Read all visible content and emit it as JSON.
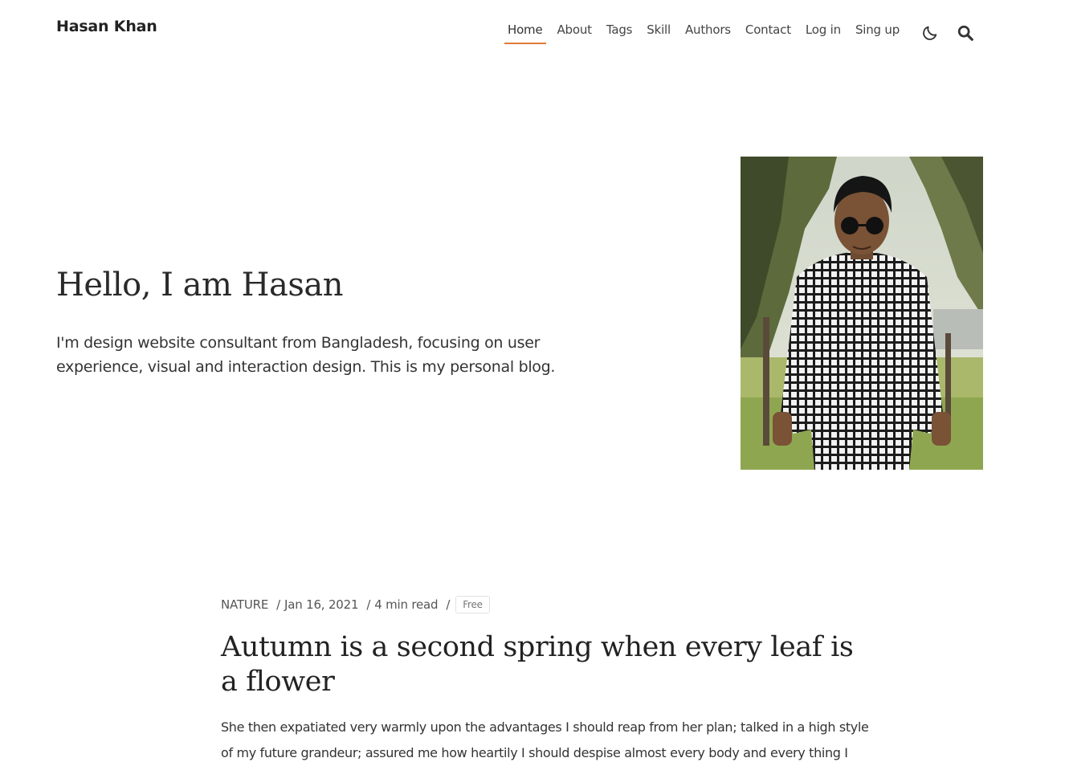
{
  "header": {
    "site_title": "Hasan Khan",
    "nav": [
      {
        "label": "Home",
        "active": true
      },
      {
        "label": "About"
      },
      {
        "label": "Tags"
      },
      {
        "label": "Skill"
      },
      {
        "label": "Authors"
      },
      {
        "label": "Contact"
      },
      {
        "label": "Log in"
      },
      {
        "label": "Sing up"
      }
    ],
    "icons": [
      "moon-icon",
      "search-icon"
    ]
  },
  "hero": {
    "title": "Hello, I am Hasan",
    "description": "I'm design website consultant from Bangladesh, focusing on user experience, visual and interaction design. This is my personal blog."
  },
  "post": {
    "category": "NATURE",
    "date": "Jan 16, 2021",
    "read_time": "4 min read",
    "badge": "Free",
    "title": "Autumn is a second spring when every leaf is a flower",
    "excerpt": "She then expatiated very warmly upon the advantages I should reap from her plan; talked in a high style of my future grandeur; assured me how heartily I should despise almost every body and every thing I had"
  },
  "colors": {
    "accent": "#e07b39",
    "text": "#222222"
  }
}
